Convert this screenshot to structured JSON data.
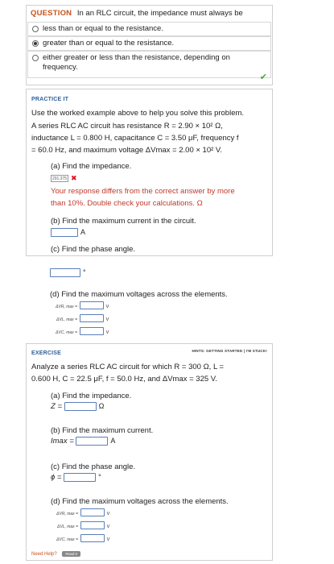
{
  "question": {
    "tag": "QUESTION",
    "text": "In an RLC circuit, the impedance must always be",
    "options": [
      {
        "label": "less than or equal to the resistance.",
        "selected": false
      },
      {
        "label": "greater than or equal to the resistance.",
        "selected": true
      },
      {
        "label": "either greater or less than the resistance, depending on frequency.",
        "selected": false
      }
    ],
    "check_icon": "checkmark-icon"
  },
  "practice": {
    "heading": "PRACTICE IT",
    "intro": "Use the worked example above to help you solve this problem.",
    "problem_line1": "A series RLC AC circuit has resistance R = 2.90 × 10² Ω,",
    "problem_line2": "inductance L = 0.800 H, capacitance C = 3.50 μF, frequency f",
    "problem_line3": "= 60.0 Hz, and maximum voltage ΔVmax = 2.00 × 10² V.",
    "a_label": "(a) Find the impedance.",
    "a_answer": "291.375",
    "a_feedback_line1": "Your response differs from the correct answer by more",
    "a_feedback_line2": "than 10%. Double check your calculations. Ω",
    "b_label": "(b) Find the maximum current in the circuit.",
    "b_unit": "A",
    "c_label": "(c) Find the phase angle.",
    "c_unit": "°",
    "d_label": "(d) Find the maximum voltages across the elements.",
    "d_rows": [
      {
        "label": "ΔVR, max =",
        "unit": "V"
      },
      {
        "label": "ΔVL, max =",
        "unit": "V"
      },
      {
        "label": "ΔVC, max =",
        "unit": "V"
      }
    ]
  },
  "exercise": {
    "heading": "EXERCISE",
    "hints": "HINTS:  GETTING STARTED  |  I'M STUCK!",
    "problem_line1": "Analyze a series RLC AC circuit for which R = 300 Ω, L =",
    "problem_line2": "0.600 H, C = 22.5 μF, f = 50.0 Hz, and ΔVmax = 325 V.",
    "a_label": "(a) Find the impedance.",
    "a_prefix": "Z =",
    "a_unit": "Ω",
    "b_label": "(b) Find the maximum current.",
    "b_prefix": "Imax =",
    "b_unit": "A",
    "c_label": "(c) Find the phase angle.",
    "c_prefix": "ϕ =",
    "c_unit": "°",
    "d_label": "(d) Find the maximum voltages across the elements.",
    "d_rows": [
      {
        "label": "ΔVR, max =",
        "unit": "V"
      },
      {
        "label": "ΔVL, max =",
        "unit": "V"
      },
      {
        "label": "ΔVC, max =",
        "unit": "V"
      }
    ],
    "need_help": "Need Help?",
    "read_it": "Read It"
  }
}
